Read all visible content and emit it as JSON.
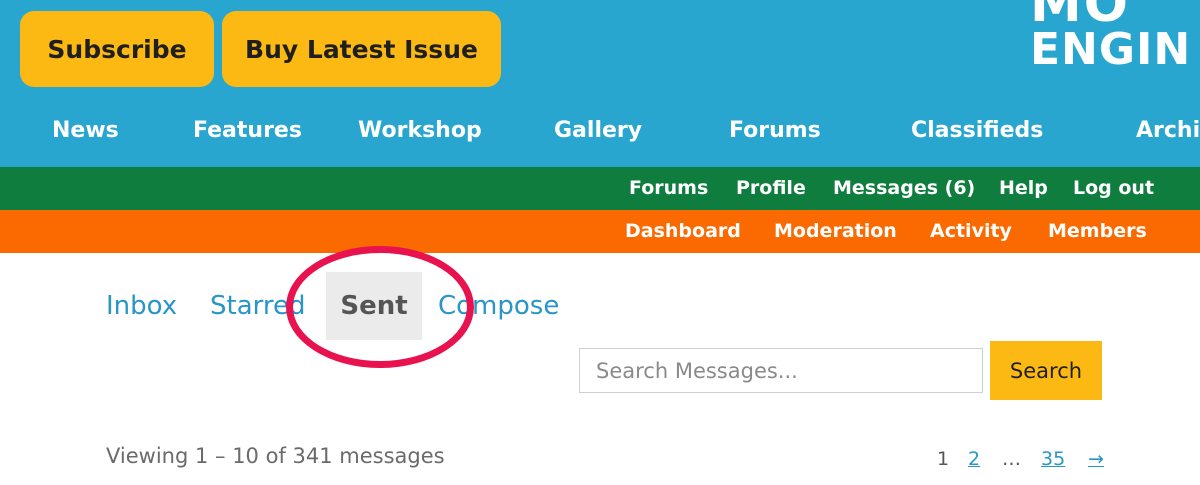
{
  "header": {
    "subscribe_label": "Subscribe",
    "buy_label": "Buy Latest Issue",
    "logo_line1": "MO",
    "logo_line2": "ENGIN"
  },
  "main_nav": [
    "News",
    "Features",
    "Workshop",
    "Gallery",
    "Forums",
    "Classifieds",
    "Archi"
  ],
  "user_nav": [
    "Forums",
    "Profile",
    "Messages (6)",
    "Help",
    "Log out"
  ],
  "admin_nav": [
    "Dashboard",
    "Moderation",
    "Activity",
    "Members"
  ],
  "tabs": {
    "inbox": "Inbox",
    "starred": "Starred",
    "sent": "Sent",
    "compose": "Compose",
    "active": "Sent"
  },
  "search": {
    "placeholder": "Search Messages...",
    "value": "",
    "button_label": "Search"
  },
  "viewing_text": "Viewing 1 – 10 of 341 messages",
  "pagination": {
    "current": "1",
    "page2": "2",
    "ellipsis": "…",
    "last": "35",
    "next": "→"
  },
  "colors": {
    "header_blue": "#29a6d0",
    "button_yellow": "#fdb913",
    "bar_green": "#0f7d3e",
    "bar_orange": "#fa6a00",
    "link_blue": "#2a95c7",
    "ring_red": "#e8124e"
  }
}
